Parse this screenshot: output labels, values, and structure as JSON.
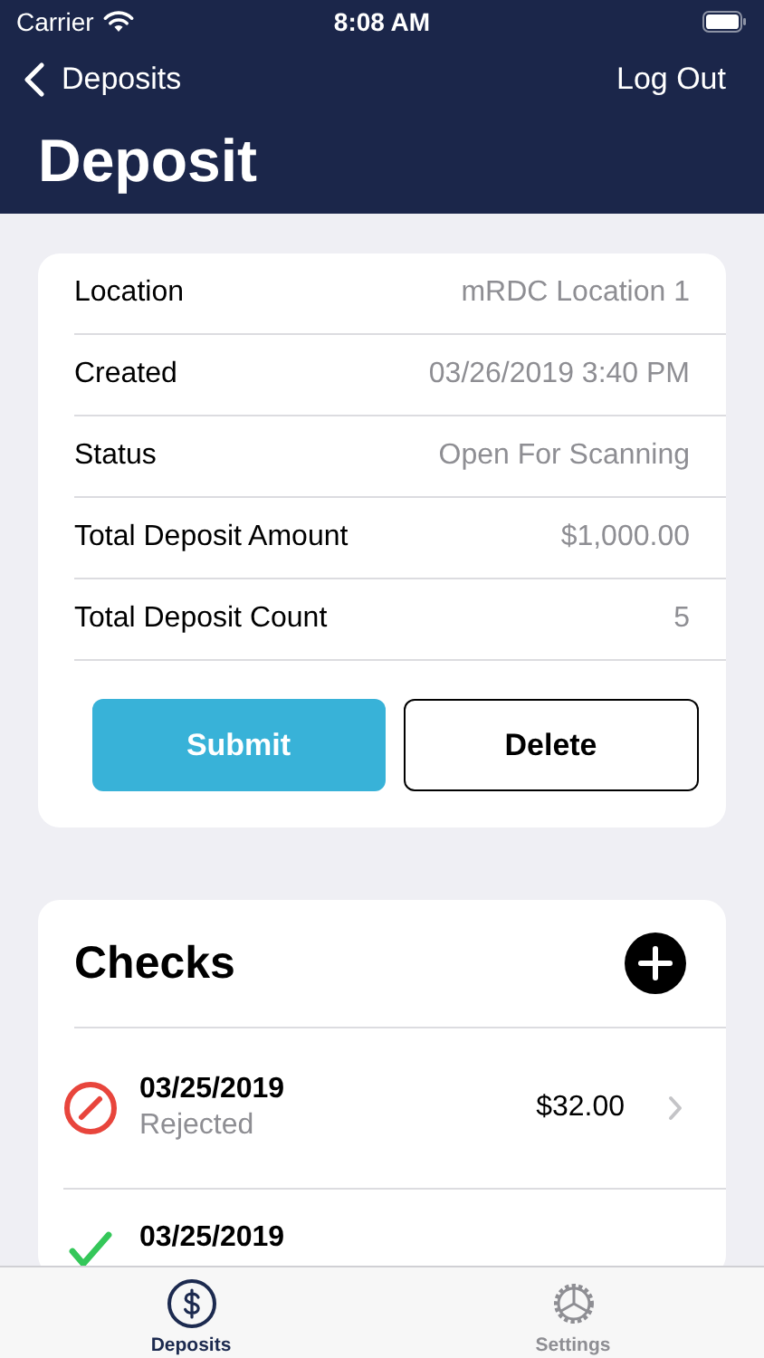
{
  "status_bar": {
    "carrier": "Carrier",
    "time": "8:08 AM"
  },
  "nav": {
    "back": "Deposits",
    "action": "Log Out",
    "title": "Deposit"
  },
  "details": [
    {
      "label": "Location",
      "value": "mRDC Location 1"
    },
    {
      "label": "Created",
      "value": "03/26/2019 3:40 PM"
    },
    {
      "label": "Status",
      "value": "Open For Scanning"
    },
    {
      "label": "Total Deposit Amount",
      "value": "$1,000.00"
    },
    {
      "label": "Total Deposit Count",
      "value": "5"
    }
  ],
  "buttons": [
    {
      "label": "Submit",
      "kind": "primary"
    },
    {
      "label": "Delete",
      "kind": "secondary"
    }
  ],
  "checks": {
    "title": "Checks",
    "items": [
      {
        "date": "03/25/2019",
        "status": "Rejected",
        "amount": "$32.00",
        "kind": "rejected"
      },
      {
        "date": "03/25/2019",
        "kind": "accepted"
      }
    ]
  },
  "tab_bar": [
    {
      "label": "Deposits",
      "kind": "dollar",
      "selected": true
    },
    {
      "label": "Settings",
      "kind": "gear",
      "selected": false
    }
  ]
}
